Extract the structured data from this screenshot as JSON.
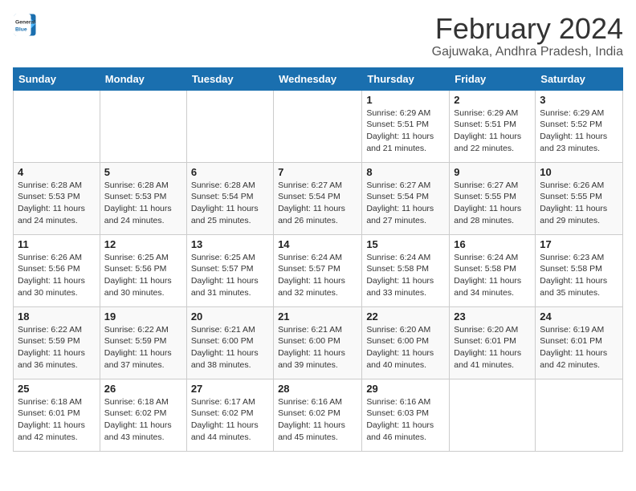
{
  "logo": {
    "line1": "General",
    "line2": "Blue"
  },
  "title": "February 2024",
  "subtitle": "Gajuwaka, Andhra Pradesh, India",
  "days_of_week": [
    "Sunday",
    "Monday",
    "Tuesday",
    "Wednesday",
    "Thursday",
    "Friday",
    "Saturday"
  ],
  "weeks": [
    [
      {
        "day": "",
        "info": ""
      },
      {
        "day": "",
        "info": ""
      },
      {
        "day": "",
        "info": ""
      },
      {
        "day": "",
        "info": ""
      },
      {
        "day": "1",
        "info": "Sunrise: 6:29 AM\nSunset: 5:51 PM\nDaylight: 11 hours and 21 minutes."
      },
      {
        "day": "2",
        "info": "Sunrise: 6:29 AM\nSunset: 5:51 PM\nDaylight: 11 hours and 22 minutes."
      },
      {
        "day": "3",
        "info": "Sunrise: 6:29 AM\nSunset: 5:52 PM\nDaylight: 11 hours and 23 minutes."
      }
    ],
    [
      {
        "day": "4",
        "info": "Sunrise: 6:28 AM\nSunset: 5:53 PM\nDaylight: 11 hours and 24 minutes."
      },
      {
        "day": "5",
        "info": "Sunrise: 6:28 AM\nSunset: 5:53 PM\nDaylight: 11 hours and 24 minutes."
      },
      {
        "day": "6",
        "info": "Sunrise: 6:28 AM\nSunset: 5:54 PM\nDaylight: 11 hours and 25 minutes."
      },
      {
        "day": "7",
        "info": "Sunrise: 6:27 AM\nSunset: 5:54 PM\nDaylight: 11 hours and 26 minutes."
      },
      {
        "day": "8",
        "info": "Sunrise: 6:27 AM\nSunset: 5:54 PM\nDaylight: 11 hours and 27 minutes."
      },
      {
        "day": "9",
        "info": "Sunrise: 6:27 AM\nSunset: 5:55 PM\nDaylight: 11 hours and 28 minutes."
      },
      {
        "day": "10",
        "info": "Sunrise: 6:26 AM\nSunset: 5:55 PM\nDaylight: 11 hours and 29 minutes."
      }
    ],
    [
      {
        "day": "11",
        "info": "Sunrise: 6:26 AM\nSunset: 5:56 PM\nDaylight: 11 hours and 30 minutes."
      },
      {
        "day": "12",
        "info": "Sunrise: 6:25 AM\nSunset: 5:56 PM\nDaylight: 11 hours and 30 minutes."
      },
      {
        "day": "13",
        "info": "Sunrise: 6:25 AM\nSunset: 5:57 PM\nDaylight: 11 hours and 31 minutes."
      },
      {
        "day": "14",
        "info": "Sunrise: 6:24 AM\nSunset: 5:57 PM\nDaylight: 11 hours and 32 minutes."
      },
      {
        "day": "15",
        "info": "Sunrise: 6:24 AM\nSunset: 5:58 PM\nDaylight: 11 hours and 33 minutes."
      },
      {
        "day": "16",
        "info": "Sunrise: 6:24 AM\nSunset: 5:58 PM\nDaylight: 11 hours and 34 minutes."
      },
      {
        "day": "17",
        "info": "Sunrise: 6:23 AM\nSunset: 5:58 PM\nDaylight: 11 hours and 35 minutes."
      }
    ],
    [
      {
        "day": "18",
        "info": "Sunrise: 6:22 AM\nSunset: 5:59 PM\nDaylight: 11 hours and 36 minutes."
      },
      {
        "day": "19",
        "info": "Sunrise: 6:22 AM\nSunset: 5:59 PM\nDaylight: 11 hours and 37 minutes."
      },
      {
        "day": "20",
        "info": "Sunrise: 6:21 AM\nSunset: 6:00 PM\nDaylight: 11 hours and 38 minutes."
      },
      {
        "day": "21",
        "info": "Sunrise: 6:21 AM\nSunset: 6:00 PM\nDaylight: 11 hours and 39 minutes."
      },
      {
        "day": "22",
        "info": "Sunrise: 6:20 AM\nSunset: 6:00 PM\nDaylight: 11 hours and 40 minutes."
      },
      {
        "day": "23",
        "info": "Sunrise: 6:20 AM\nSunset: 6:01 PM\nDaylight: 11 hours and 41 minutes."
      },
      {
        "day": "24",
        "info": "Sunrise: 6:19 AM\nSunset: 6:01 PM\nDaylight: 11 hours and 42 minutes."
      }
    ],
    [
      {
        "day": "25",
        "info": "Sunrise: 6:18 AM\nSunset: 6:01 PM\nDaylight: 11 hours and 42 minutes."
      },
      {
        "day": "26",
        "info": "Sunrise: 6:18 AM\nSunset: 6:02 PM\nDaylight: 11 hours and 43 minutes."
      },
      {
        "day": "27",
        "info": "Sunrise: 6:17 AM\nSunset: 6:02 PM\nDaylight: 11 hours and 44 minutes."
      },
      {
        "day": "28",
        "info": "Sunrise: 6:16 AM\nSunset: 6:02 PM\nDaylight: 11 hours and 45 minutes."
      },
      {
        "day": "29",
        "info": "Sunrise: 6:16 AM\nSunset: 6:03 PM\nDaylight: 11 hours and 46 minutes."
      },
      {
        "day": "",
        "info": ""
      },
      {
        "day": "",
        "info": ""
      }
    ]
  ]
}
